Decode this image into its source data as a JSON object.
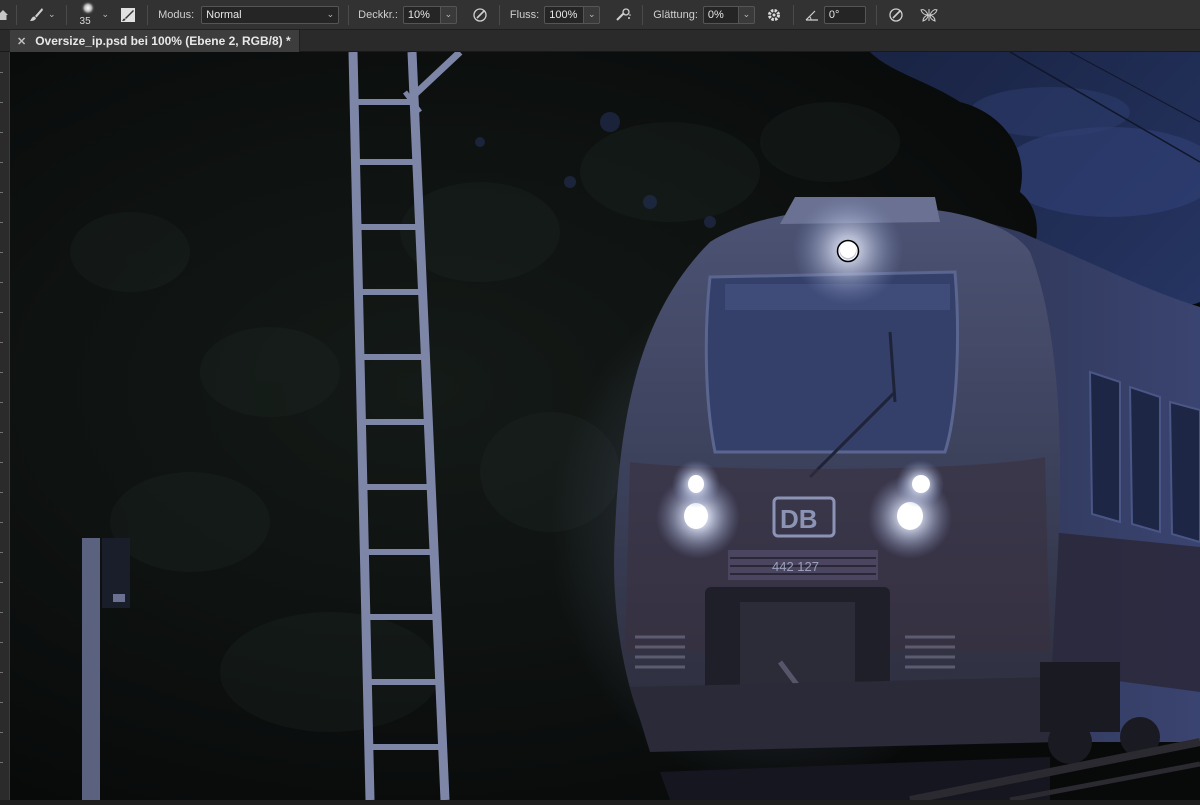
{
  "options_bar": {
    "brush_size": "35",
    "mode_label": "Modus:",
    "mode_value": "Normal",
    "opacity_label": "Deckkr.:",
    "opacity_value": "10%",
    "flow_label": "Fluss:",
    "flow_value": "100%",
    "smoothing_label": "Glättung:",
    "smoothing_value": "0%",
    "angle_value": "0°",
    "icons": [
      "home-icon",
      "brush-tool-icon",
      "brush-preset-icon",
      "brush-settings-icon",
      "pressure-opacity-icon",
      "airbrush-icon",
      "smoothing-settings-icon",
      "angle-icon",
      "pressure-size-icon",
      "symmetry-icon"
    ]
  },
  "document_tab": {
    "title": "Oversize_ip.psd bei 100% (Ebene 2, RGB/8) *"
  },
  "canvas": {
    "train_number": "442 127",
    "logo_text": "DB",
    "colors": {
      "sky": "#1e2a4e",
      "trees": "#0c100e",
      "train_body": "#3a4060",
      "headlight": "#ffffff"
    }
  }
}
